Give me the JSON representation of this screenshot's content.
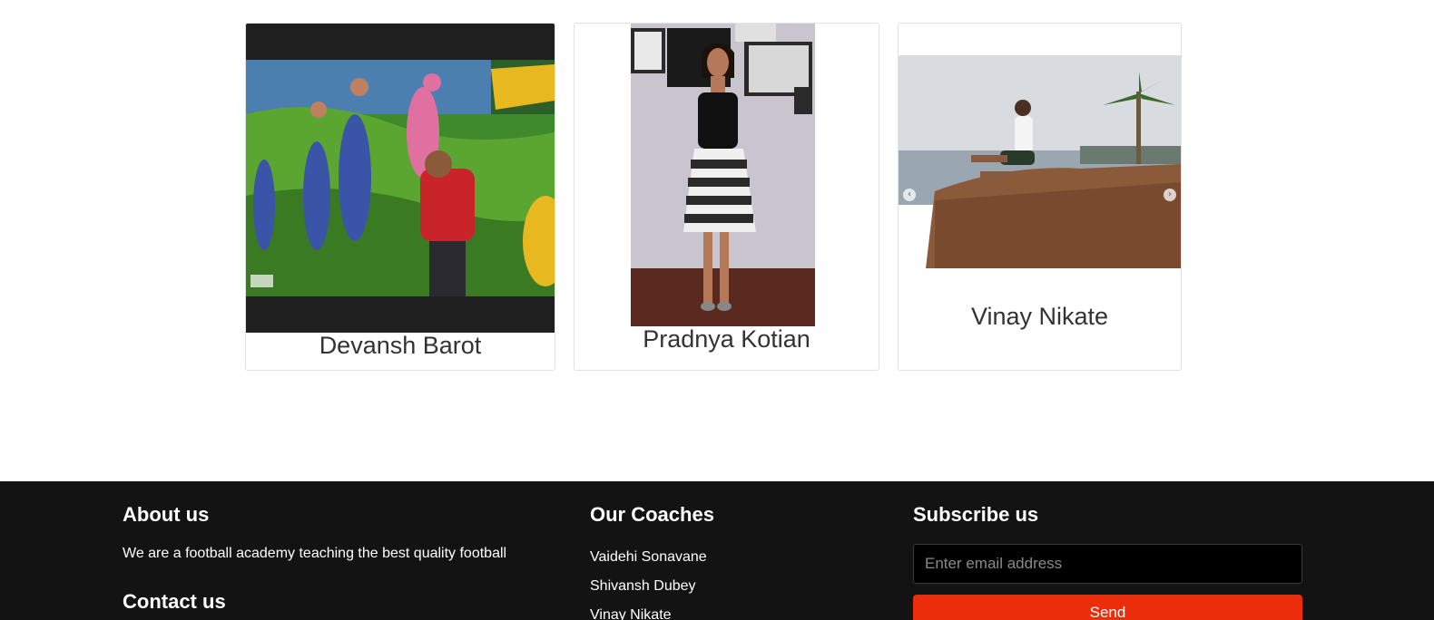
{
  "team": {
    "cards": [
      {
        "name": "Devansh Barot"
      },
      {
        "name": "Pradnya Kotian"
      },
      {
        "name": "Vinay Nikate"
      }
    ],
    "carousel": {
      "prev_symbol": "‹",
      "next_symbol": "›"
    }
  },
  "footer": {
    "about": {
      "heading": "About us",
      "text": "We are a football academy teaching the best quality football"
    },
    "contact": {
      "heading": "Contact us"
    },
    "coaches": {
      "heading": "Our Coaches",
      "items": [
        "Vaidehi Sonavane",
        "Shivansh Dubey",
        "Vinay Nikate"
      ]
    },
    "subscribe": {
      "heading": "Subscribe us",
      "email_placeholder": "Enter email address",
      "button_label": "Send"
    }
  },
  "colors": {
    "footer_bg": "#131313",
    "accent": "#ec2d0c",
    "card_border": "#e2e2e2"
  }
}
